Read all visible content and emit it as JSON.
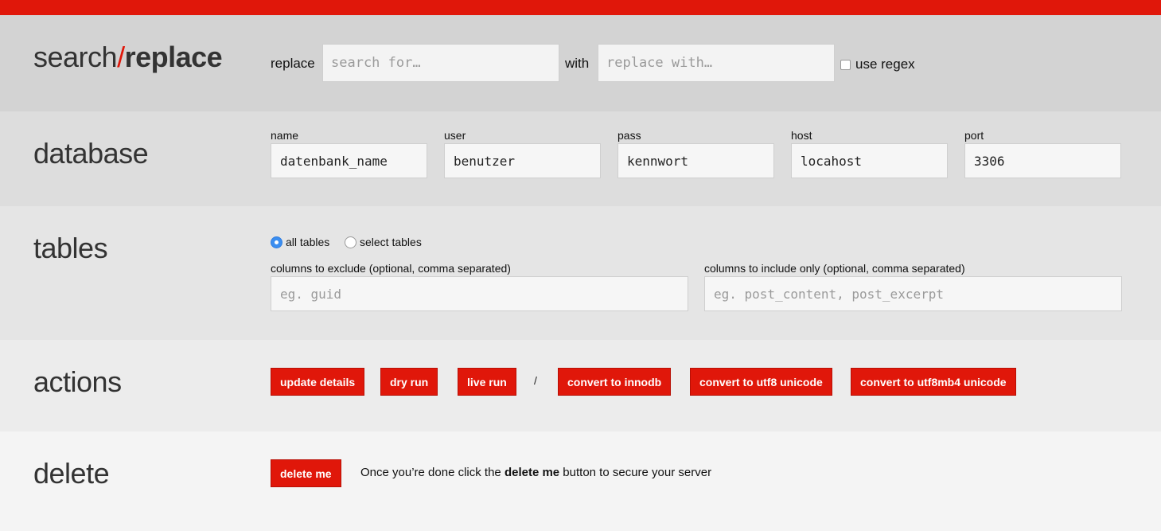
{
  "colors": {
    "accent": "#e0170a",
    "radio_checked": "#3b8ef0"
  },
  "search": {
    "title_part1": "search",
    "title_slash": "/",
    "title_part2": "replace",
    "replace_label": "replace",
    "search_placeholder": "search for…",
    "with_label": "with",
    "replace_placeholder": "replace with…",
    "regex_label": "use regex",
    "regex_checked": false
  },
  "database": {
    "title": "database",
    "fields": [
      {
        "label": "name",
        "value": "datenbank_name"
      },
      {
        "label": "user",
        "value": "benutzer"
      },
      {
        "label": "pass",
        "value": "kennwort"
      },
      {
        "label": "host",
        "value": "locahost"
      },
      {
        "label": "port",
        "value": "3306"
      }
    ]
  },
  "tables": {
    "title": "tables",
    "radio_all": "all tables",
    "radio_select": "select tables",
    "selected": "all tables",
    "exclude_label": "columns to exclude (optional, comma separated)",
    "exclude_placeholder": "eg. guid",
    "include_label": "columns to include only (optional, comma separated)",
    "include_placeholder": "eg. post_content, post_excerpt"
  },
  "actions": {
    "title": "actions",
    "update_details": "update details",
    "dry_run": "dry run",
    "live_run": "live run",
    "separator": "/",
    "convert_innodb": "convert to innodb",
    "convert_utf8": "convert to utf8 unicode",
    "convert_utf8mb4": "convert to utf8mb4 unicode"
  },
  "delete": {
    "title": "delete",
    "button": "delete me",
    "note_before": "Once you’re done click the ",
    "note_bold": "delete me",
    "note_after": " button to secure your server"
  }
}
